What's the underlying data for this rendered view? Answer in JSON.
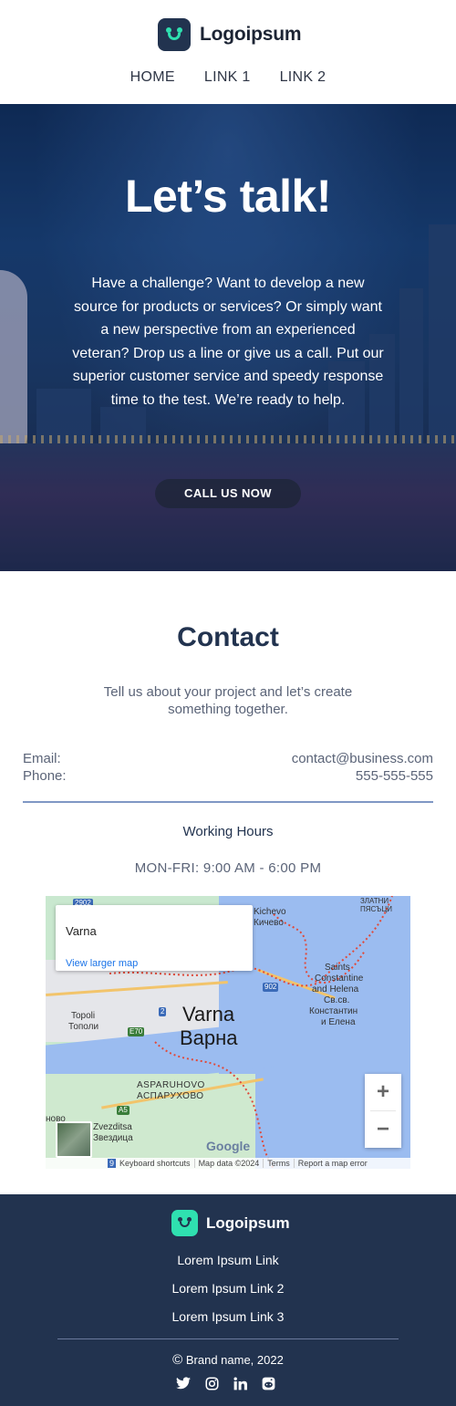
{
  "header": {
    "logo_text": "Logoipsum",
    "nav": [
      "HOME",
      "LINK 1",
      "LINK 2"
    ]
  },
  "hero": {
    "title": "Let’s talk!",
    "body": "Have a challenge? Want to develop a new source for products or services? Or simply want a new perspective from an experienced veteran? Drop us a line or give us a call. Put our superior customer service and speedy response time to the test. We’re ready to help.",
    "cta_label": "CALL US NOW"
  },
  "contact": {
    "title": "Contact",
    "subtitle": "Tell us about your project and let’s create something together.",
    "email_label": "Email:",
    "email_value": "contact@business.com",
    "phone_label": "Phone:",
    "phone_value": "555-555-555",
    "working_hours_title": "Working Hours",
    "working_hours_value": "MON-FRI: 9:00 AM - 6:00 PM"
  },
  "map": {
    "place_name": "Varna",
    "view_larger": "View larger map",
    "city_latin": "Varna",
    "city_cyrillic": "Варна",
    "labels": {
      "kichevo": "Kichevo",
      "kichevo_cyr": "Кичево",
      "saints": "Saints",
      "constantine": "Constantine",
      "and_helena": "and Helena",
      "sv_short": "Св.св.",
      "konstantin": "Константин",
      "i_elena": "и Елена",
      "topoli": "Topoli",
      "topoli_cyr": "Тополи",
      "asparuhovo": "ASPARUHOVO",
      "asparuhovo_cyr": "АСПАРУХОВО",
      "zvezditsa": "Zvezditsa",
      "zvezditsa_cyr": "Звездица",
      "novo": "ново",
      "zlatni": "ЗЛАТНИ",
      "pyasatsi": "ПЯСЪЦИ"
    },
    "shields": {
      "e70": "E70",
      "r2": "2",
      "r902": "902",
      "a5": "A5",
      "r9": "9",
      "r2902": "2902"
    },
    "google": "Google",
    "footer": {
      "keyboard": "Keyboard shortcuts",
      "map_data": "Map data ©2024",
      "terms": "Terms",
      "report": "Report a map error"
    },
    "zoom_in": "+",
    "zoom_out": "−"
  },
  "footer": {
    "logo_text": "Logoipsum",
    "links": [
      "Lorem Ipsum Link",
      "Lorem Ipsum Link 2",
      "Lorem Ipsum Link 3"
    ],
    "copyright": "Brand name, 2022",
    "copyright_symbol": "©",
    "socials": [
      "twitter-icon",
      "instagram-icon",
      "linkedin-icon",
      "reddit-icon"
    ]
  },
  "colors": {
    "navy": "#22334f",
    "accent": "#2fe0b0",
    "divider": "#7f97c4"
  }
}
